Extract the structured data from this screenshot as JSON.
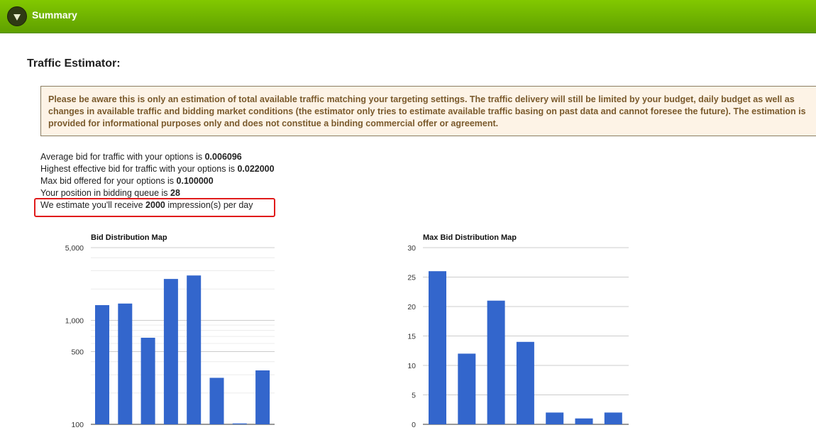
{
  "header": {
    "title": "Summary"
  },
  "page": {
    "title": "Traffic Estimator:"
  },
  "notice": {
    "text": "Please be aware this is only an estimation of total available traffic matching your targeting settings. The traffic delivery will still be limited by your budget, daily budget as well as changes in available traffic and bidding market conditions (the estimator only tries to estimate available traffic basing on past data and cannot foresee the future). The estimation is provided for informational purposes only and does not constitue a binding commercial offer or agreement."
  },
  "stats": {
    "avg_bid": {
      "prefix": "Average bid for traffic with your options is ",
      "value": "0.006096",
      "suffix": ""
    },
    "highest_bid": {
      "prefix": "Highest effective bid for traffic with your options is ",
      "value": "0.022000",
      "suffix": ""
    },
    "max_bid": {
      "prefix": "Max bid offered for your options is ",
      "value": "0.100000",
      "suffix": ""
    },
    "position": {
      "prefix": "Your position in bidding queue is ",
      "value": "28",
      "suffix": ""
    },
    "estimate": {
      "prefix": "We estimate you'll receive ",
      "value": "2000",
      "suffix": " impression(s) per day"
    }
  },
  "colors": {
    "bar": "#3366cc",
    "header": "#6cb000",
    "highlight": "#e01b1b"
  },
  "chart_data": [
    {
      "type": "bar",
      "title": "Bid Distribution Map",
      "scale": "log",
      "ylim": [
        100,
        5000
      ],
      "yticks": [
        100,
        500,
        1000,
        5000
      ],
      "ytick_labels": [
        "100",
        "500",
        "1,000",
        "5,000"
      ],
      "values": [
        1400,
        1450,
        680,
        2500,
        2700,
        280,
        102,
        330
      ],
      "grid": true
    },
    {
      "type": "bar",
      "title": "Max Bid Distribution Map",
      "scale": "linear",
      "ylim": [
        0,
        30
      ],
      "yticks": [
        0,
        5,
        10,
        15,
        20,
        25,
        30
      ],
      "ytick_labels": [
        "0",
        "5",
        "10",
        "15",
        "20",
        "25",
        "30"
      ],
      "values": [
        26,
        12,
        21,
        14,
        2,
        1,
        2
      ],
      "grid": true
    }
  ]
}
